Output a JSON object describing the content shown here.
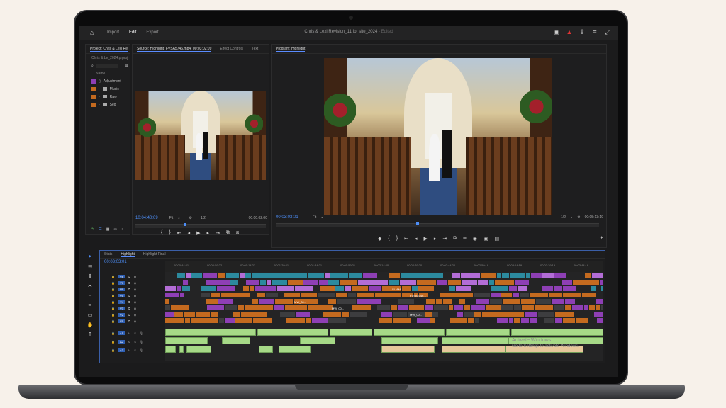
{
  "header": {
    "tabs": [
      "Import",
      "Edit",
      "Export"
    ],
    "active_tab": "Edit",
    "title": "Chris & Lexi Revision_11 for site_2024",
    "title_suffix": " - Edited"
  },
  "project_panel": {
    "tab": "Project: Chris & Lexi Re",
    "file": "Chris & Le_2024.prproj",
    "column_header": "Name",
    "items": [
      {
        "label": "Adjustment",
        "color": "#8e3fb5"
      },
      {
        "label": "Music",
        "color": "#c46a1f"
      },
      {
        "label": "Raw",
        "color": "#c46a1f"
      },
      {
        "label": "Seq",
        "color": "#c46a1f"
      }
    ]
  },
  "source_panel": {
    "tabs": [
      "Source: Highlight: FVSA5746.mp4: 00:03:02:09",
      "Effect Controls",
      "Text"
    ],
    "timecode": "10:04:40:09",
    "fit": "Fit",
    "scale": "1/2",
    "duration": "00:00:02:00"
  },
  "program_panel": {
    "tab": "Program: Highlight",
    "timecode": "00:03:03:01",
    "fit": "Fit",
    "scale": "1/2",
    "duration": "00:05:13:19"
  },
  "timeline": {
    "tabs": [
      "Stats",
      "Highlight",
      "Highlight Final"
    ],
    "active_tab": "Highlight",
    "timecode": "00:03:03:01",
    "ruler_ticks": [
      "00:00:44:21",
      "00:00:59:22",
      "00:01:14:22",
      "00:01:29:21",
      "00:01:44:21",
      "00:01:59:21",
      "00:02:14:20",
      "00:02:29:20",
      "00:02:44:20",
      "00:02:59:19",
      "00:03:14:19",
      "00:03:29:19",
      "00:03:44:18"
    ],
    "video_tracks": [
      "V8",
      "V7",
      "V6",
      "V5",
      "V4",
      "V3",
      "V2",
      "V1"
    ],
    "audio_tracks": [
      "A1",
      "A2",
      "A3"
    ],
    "clip_labels": [
      "SLIAM...",
      "FVSA5746...",
      "MW_00...",
      "MW_00...",
      "MW_00..."
    ]
  },
  "watermark": {
    "line1": "Activate Windows",
    "line2": "Go to Settings to activate Windows."
  },
  "colors": {
    "accent": "#4d8ef7",
    "video_purple": "#8e3fb5",
    "video_teal": "#2c8a9e",
    "video_orange": "#c46a1f",
    "audio_green": "#a6d987"
  }
}
